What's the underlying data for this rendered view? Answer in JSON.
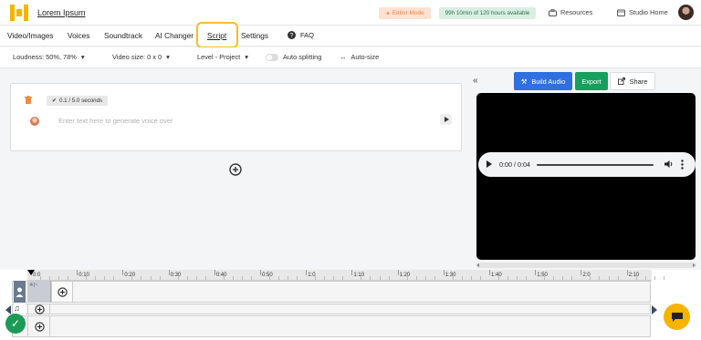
{
  "header": {
    "brand": "Lorem Ipsum",
    "editor_mode": "Editor Mode",
    "hours_available": "99h 10min of 120 hours available",
    "resources": "Resources",
    "studio_home": "Studio Home"
  },
  "nav": {
    "tabs": [
      "Video/Images",
      "Voices",
      "Soundtrack",
      "AI Changer",
      "Script",
      "Settings"
    ],
    "faq": "FAQ"
  },
  "toolbar": {
    "loudness": "Loudness: 50%, 78%",
    "video_size": "Video size: 0 x 0",
    "level": "Level - Project",
    "auto_splitting": "Auto splitting",
    "auto_size": "Auto-size"
  },
  "editor": {
    "duration": "0.1 / 5.0 seconds",
    "placeholder": "Enter text here to generate voice over"
  },
  "actions": {
    "build_audio": "Build Audio",
    "export": "Export",
    "share": "Share"
  },
  "player": {
    "time": "0:00 / 0:04"
  },
  "timeline": {
    "ticks": [
      "0:0",
      "0:10",
      "0:20",
      "0:30",
      "0:40",
      "0:50",
      "1:0",
      "1:10",
      "1:20",
      "1:30",
      "1:40",
      "1:50",
      "2:0",
      "2:10"
    ],
    "clip_label": "※|~"
  },
  "colors": {
    "build_audio": "#2f6fe0",
    "export": "#16a05d",
    "highlight": "#f4be2a",
    "chat_fab": "#f6b400"
  }
}
